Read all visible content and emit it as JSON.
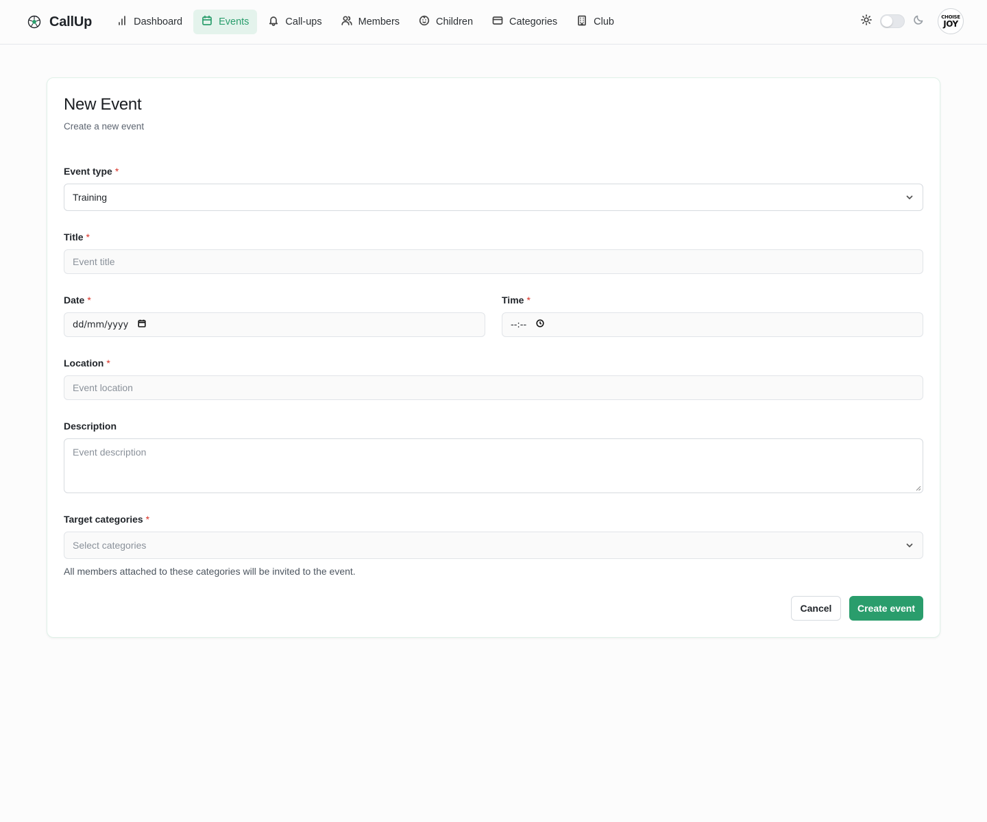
{
  "app": {
    "name": "CallUp"
  },
  "nav": {
    "items": [
      {
        "label": "Dashboard",
        "icon": "bar-chart-icon"
      },
      {
        "label": "Events",
        "icon": "calendar-icon",
        "active": true
      },
      {
        "label": "Call-ups",
        "icon": "bell-icon"
      },
      {
        "label": "Members",
        "icon": "users-icon"
      },
      {
        "label": "Children",
        "icon": "baby-face-icon"
      },
      {
        "label": "Categories",
        "icon": "card-icon"
      },
      {
        "label": "Club",
        "icon": "building-icon"
      }
    ]
  },
  "header_tools": {
    "theme_toggle": {
      "state": "light"
    },
    "avatar": {
      "line1": "CHOISE",
      "line2": "JOY"
    }
  },
  "page": {
    "title": "New Event",
    "subtitle": "Create a new event"
  },
  "form": {
    "event_type": {
      "label": "Event type",
      "required_mark": "*",
      "value": "Training"
    },
    "title": {
      "label": "Title",
      "required_mark": "*",
      "placeholder": "Event title"
    },
    "date": {
      "label": "Date",
      "required_mark": "*",
      "value": "dd/mm/yyyy"
    },
    "time": {
      "label": "Time",
      "required_mark": "*",
      "value": "--:--"
    },
    "location": {
      "label": "Location",
      "required_mark": "*",
      "placeholder": "Event location"
    },
    "description": {
      "label": "Description",
      "placeholder": "Event description"
    },
    "target_categories": {
      "label": "Target categories",
      "required_mark": "*",
      "placeholder": "Select categories",
      "helper": "All members attached to these categories will be invited to the event."
    }
  },
  "actions": {
    "cancel_label": "Cancel",
    "create_label": "Create event"
  },
  "colors": {
    "accent": "#2a9d6c",
    "active_nav_bg": "#e4f3ec",
    "required": "#d93025"
  }
}
